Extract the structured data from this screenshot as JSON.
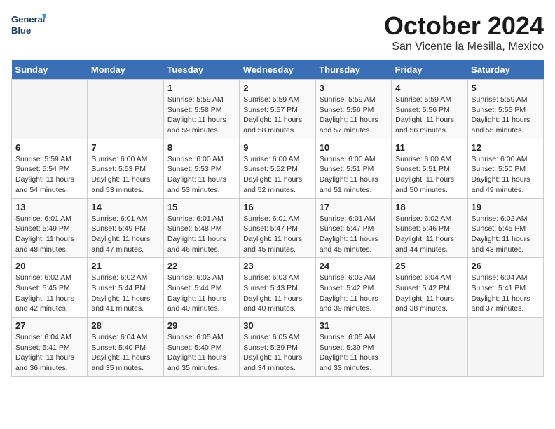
{
  "header": {
    "logo_line1": "General",
    "logo_line2": "Blue",
    "month": "October 2024",
    "location": "San Vicente la Mesilla, Mexico"
  },
  "days_of_week": [
    "Sunday",
    "Monday",
    "Tuesday",
    "Wednesday",
    "Thursday",
    "Friday",
    "Saturday"
  ],
  "weeks": [
    [
      {
        "day": "",
        "content": ""
      },
      {
        "day": "",
        "content": ""
      },
      {
        "day": "1",
        "content": "Sunrise: 5:59 AM\nSunset: 5:58 PM\nDaylight: 11 hours and 59 minutes."
      },
      {
        "day": "2",
        "content": "Sunrise: 5:59 AM\nSunset: 5:57 PM\nDaylight: 11 hours and 58 minutes."
      },
      {
        "day": "3",
        "content": "Sunrise: 5:59 AM\nSunset: 5:56 PM\nDaylight: 11 hours and 57 minutes."
      },
      {
        "day": "4",
        "content": "Sunrise: 5:59 AM\nSunset: 5:56 PM\nDaylight: 11 hours and 56 minutes."
      },
      {
        "day": "5",
        "content": "Sunrise: 5:59 AM\nSunset: 5:55 PM\nDaylight: 11 hours and 55 minutes."
      }
    ],
    [
      {
        "day": "6",
        "content": "Sunrise: 5:59 AM\nSunset: 5:54 PM\nDaylight: 11 hours and 54 minutes."
      },
      {
        "day": "7",
        "content": "Sunrise: 6:00 AM\nSunset: 5:53 PM\nDaylight: 11 hours and 53 minutes."
      },
      {
        "day": "8",
        "content": "Sunrise: 6:00 AM\nSunset: 5:53 PM\nDaylight: 11 hours and 53 minutes."
      },
      {
        "day": "9",
        "content": "Sunrise: 6:00 AM\nSunset: 5:52 PM\nDaylight: 11 hours and 52 minutes."
      },
      {
        "day": "10",
        "content": "Sunrise: 6:00 AM\nSunset: 5:51 PM\nDaylight: 11 hours and 51 minutes."
      },
      {
        "day": "11",
        "content": "Sunrise: 6:00 AM\nSunset: 5:51 PM\nDaylight: 11 hours and 50 minutes."
      },
      {
        "day": "12",
        "content": "Sunrise: 6:00 AM\nSunset: 5:50 PM\nDaylight: 11 hours and 49 minutes."
      }
    ],
    [
      {
        "day": "13",
        "content": "Sunrise: 6:01 AM\nSunset: 5:49 PM\nDaylight: 11 hours and 48 minutes."
      },
      {
        "day": "14",
        "content": "Sunrise: 6:01 AM\nSunset: 5:49 PM\nDaylight: 11 hours and 47 minutes."
      },
      {
        "day": "15",
        "content": "Sunrise: 6:01 AM\nSunset: 5:48 PM\nDaylight: 11 hours and 46 minutes."
      },
      {
        "day": "16",
        "content": "Sunrise: 6:01 AM\nSunset: 5:47 PM\nDaylight: 11 hours and 45 minutes."
      },
      {
        "day": "17",
        "content": "Sunrise: 6:01 AM\nSunset: 5:47 PM\nDaylight: 11 hours and 45 minutes."
      },
      {
        "day": "18",
        "content": "Sunrise: 6:02 AM\nSunset: 5:46 PM\nDaylight: 11 hours and 44 minutes."
      },
      {
        "day": "19",
        "content": "Sunrise: 6:02 AM\nSunset: 5:45 PM\nDaylight: 11 hours and 43 minutes."
      }
    ],
    [
      {
        "day": "20",
        "content": "Sunrise: 6:02 AM\nSunset: 5:45 PM\nDaylight: 11 hours and 42 minutes."
      },
      {
        "day": "21",
        "content": "Sunrise: 6:02 AM\nSunset: 5:44 PM\nDaylight: 11 hours and 41 minutes."
      },
      {
        "day": "22",
        "content": "Sunrise: 6:03 AM\nSunset: 5:44 PM\nDaylight: 11 hours and 40 minutes."
      },
      {
        "day": "23",
        "content": "Sunrise: 6:03 AM\nSunset: 5:43 PM\nDaylight: 11 hours and 40 minutes."
      },
      {
        "day": "24",
        "content": "Sunrise: 6:03 AM\nSunset: 5:42 PM\nDaylight: 11 hours and 39 minutes."
      },
      {
        "day": "25",
        "content": "Sunrise: 6:04 AM\nSunset: 5:42 PM\nDaylight: 11 hours and 38 minutes."
      },
      {
        "day": "26",
        "content": "Sunrise: 6:04 AM\nSunset: 5:41 PM\nDaylight: 11 hours and 37 minutes."
      }
    ],
    [
      {
        "day": "27",
        "content": "Sunrise: 6:04 AM\nSunset: 5:41 PM\nDaylight: 11 hours and 36 minutes."
      },
      {
        "day": "28",
        "content": "Sunrise: 6:04 AM\nSunset: 5:40 PM\nDaylight: 11 hours and 35 minutes."
      },
      {
        "day": "29",
        "content": "Sunrise: 6:05 AM\nSunset: 5:40 PM\nDaylight: 11 hours and 35 minutes."
      },
      {
        "day": "30",
        "content": "Sunrise: 6:05 AM\nSunset: 5:39 PM\nDaylight: 11 hours and 34 minutes."
      },
      {
        "day": "31",
        "content": "Sunrise: 6:05 AM\nSunset: 5:39 PM\nDaylight: 11 hours and 33 minutes."
      },
      {
        "day": "",
        "content": ""
      },
      {
        "day": "",
        "content": ""
      }
    ]
  ]
}
